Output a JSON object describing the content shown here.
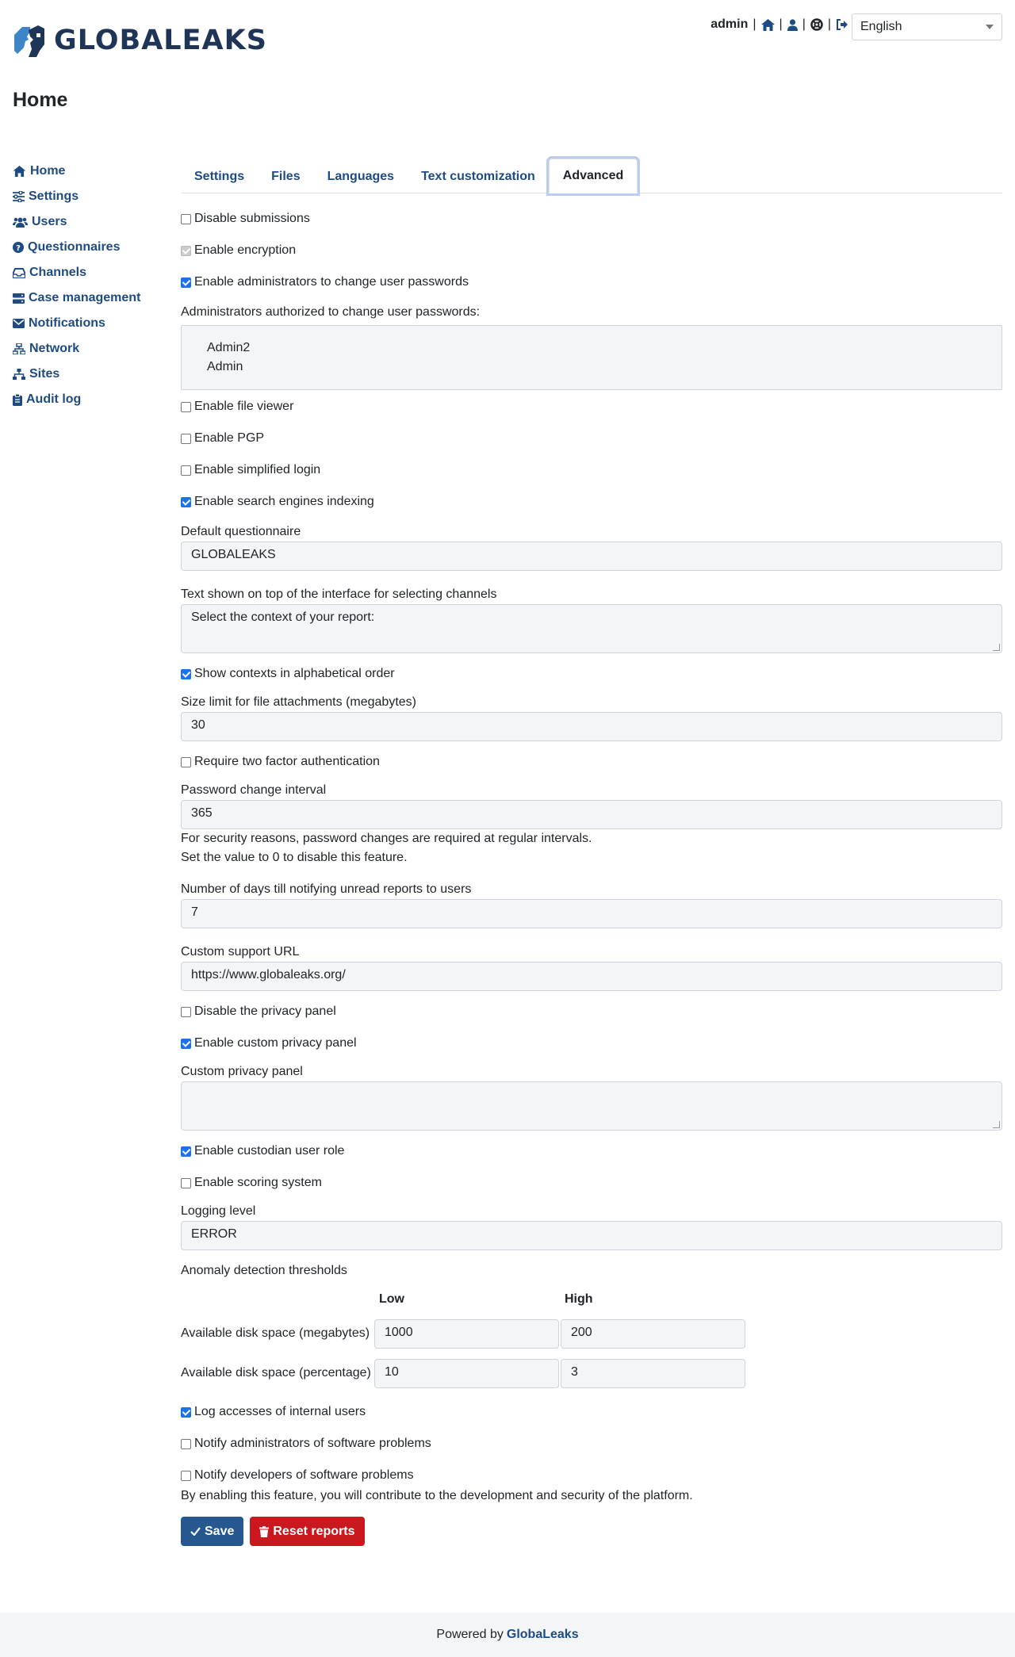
{
  "app": {
    "logo_text": "GLOBALEAKS",
    "page_title": "Home"
  },
  "userbar": {
    "username": "admin",
    "separator": "|"
  },
  "language": {
    "selected": "English"
  },
  "sidebar": {
    "items": [
      {
        "label": "Home",
        "icon": "home-icon"
      },
      {
        "label": "Settings",
        "icon": "sliders-icon"
      },
      {
        "label": "Users",
        "icon": "users-icon"
      },
      {
        "label": "Questionnaires",
        "icon": "question-circle-icon"
      },
      {
        "label": "Channels",
        "icon": "inbox-icon"
      },
      {
        "label": "Case management",
        "icon": "server-icon"
      },
      {
        "label": "Notifications",
        "icon": "envelope-icon"
      },
      {
        "label": "Network",
        "icon": "network-icon"
      },
      {
        "label": "Sites",
        "icon": "sitemap-icon"
      },
      {
        "label": "Audit log",
        "icon": "clipboard-icon"
      }
    ]
  },
  "tabs": [
    {
      "label": "Settings",
      "active": false
    },
    {
      "label": "Files",
      "active": false
    },
    {
      "label": "Languages",
      "active": false
    },
    {
      "label": "Text customization",
      "active": false
    },
    {
      "label": "Advanced",
      "active": true
    }
  ],
  "form": {
    "disable_submissions": {
      "label": "Disable submissions",
      "checked": false
    },
    "enable_encryption": {
      "label": "Enable encryption",
      "checked": true,
      "disabled": true
    },
    "enable_admin_change_pw": {
      "label": "Enable administrators to change user passwords",
      "checked": true
    },
    "admins_authorized_label": "Administrators authorized to change user passwords:",
    "admins_authorized": [
      "Admin2",
      "Admin"
    ],
    "enable_file_viewer": {
      "label": "Enable file viewer",
      "checked": false
    },
    "enable_pgp": {
      "label": "Enable PGP",
      "checked": false
    },
    "enable_simplified_login": {
      "label": "Enable simplified login",
      "checked": false
    },
    "enable_search_indexing": {
      "label": "Enable search engines indexing",
      "checked": true
    },
    "default_questionnaire": {
      "label": "Default questionnaire",
      "value": "GLOBALEAKS"
    },
    "context_selector_text": {
      "label": "Text shown on top of the interface for selecting channels",
      "value": "Select the context of your report:"
    },
    "contexts_alphabetical": {
      "label": "Show contexts in alphabetical order",
      "checked": true
    },
    "file_size_limit": {
      "label": "Size limit for file attachments (megabytes)",
      "value": "30"
    },
    "require_2fa": {
      "label": "Require two factor authentication",
      "checked": false
    },
    "password_interval": {
      "label": "Password change interval",
      "value": "365",
      "help1": "For security reasons, password changes are required at regular intervals.",
      "help2": "Set the value to 0 to disable this feature."
    },
    "unread_reports_days": {
      "label": "Number of days till notifying unread reports to users",
      "value": "7"
    },
    "custom_support_url": {
      "label": "Custom support URL",
      "value": "https://www.globaleaks.org/"
    },
    "disable_privacy_panel": {
      "label": "Disable the privacy panel",
      "checked": false
    },
    "enable_custom_privacy_panel": {
      "label": "Enable custom privacy panel",
      "checked": true
    },
    "custom_privacy_panel": {
      "label": "Custom privacy panel",
      "value": ""
    },
    "enable_custodian": {
      "label": "Enable custodian user role",
      "checked": true
    },
    "enable_scoring": {
      "label": "Enable scoring system",
      "checked": false
    },
    "logging_level": {
      "label": "Logging level",
      "value": "ERROR"
    },
    "anomaly": {
      "label": "Anomaly detection thresholds",
      "low_header": "Low",
      "high_header": "High",
      "rows": [
        {
          "label": "Available disk space (megabytes)",
          "low": "1000",
          "high": "200"
        },
        {
          "label": "Available disk space (percentage)",
          "low": "10",
          "high": "3"
        }
      ]
    },
    "log_internal_access": {
      "label": "Log accesses of internal users",
      "checked": true
    },
    "notify_admins": {
      "label": "Notify administrators of software problems",
      "checked": false
    },
    "notify_devs": {
      "label": "Notify developers of software problems",
      "checked": false,
      "help": "By enabling this feature, you will contribute to the development and security of the platform."
    }
  },
  "buttons": {
    "save": "Save",
    "reset": "Reset reports"
  },
  "footer": {
    "prefix": "Powered by",
    "link": "GlobaLeaks"
  },
  "colors": {
    "primary": "#26588f",
    "danger": "#c9191f",
    "link": "#1e4b82"
  }
}
